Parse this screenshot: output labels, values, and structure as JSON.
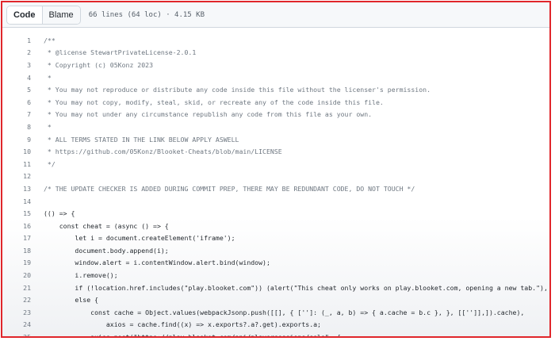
{
  "toolbar": {
    "code_label": "Code",
    "blame_label": "Blame",
    "file_meta": "66 lines (64 loc) · 4.15 KB"
  },
  "code_lines": [
    {
      "n": "1",
      "text": "/**",
      "kind": "comment"
    },
    {
      "n": "2",
      "text": " * @license StewartPrivateLicense-2.0.1",
      "kind": "comment"
    },
    {
      "n": "3",
      "text": " * Copyright (c) 05Konz 2023",
      "kind": "comment"
    },
    {
      "n": "4",
      "text": " *",
      "kind": "comment"
    },
    {
      "n": "5",
      "text": " * You may not reproduce or distribute any code inside this file without the licenser's permission.",
      "kind": "comment"
    },
    {
      "n": "6",
      "text": " * You may not copy, modify, steal, skid, or recreate any of the code inside this file.",
      "kind": "comment"
    },
    {
      "n": "7",
      "text": " * You may not under any circumstance republish any code from this file as your own.",
      "kind": "comment"
    },
    {
      "n": "8",
      "text": " *",
      "kind": "comment"
    },
    {
      "n": "9",
      "text": " * ALL TERMS STATED IN THE LINK BELOW APPLY ASWELL",
      "kind": "comment"
    },
    {
      "n": "10",
      "text": " * https://github.com/05Konz/Blooket-Cheats/blob/main/LICENSE",
      "kind": "comment"
    },
    {
      "n": "11",
      "text": " */",
      "kind": "comment"
    },
    {
      "n": "12",
      "text": "",
      "kind": "code"
    },
    {
      "n": "13",
      "text": "/* THE UPDATE CHECKER IS ADDED DURING COMMIT PREP, THERE MAY BE REDUNDANT CODE, DO NOT TOUCH */",
      "kind": "comment"
    },
    {
      "n": "14",
      "text": "",
      "kind": "code"
    },
    {
      "n": "15",
      "text": "(() => {",
      "kind": "code"
    },
    {
      "n": "16",
      "text": "    const cheat = (async () => {",
      "kind": "code"
    },
    {
      "n": "17",
      "text": "        let i = document.createElement('iframe');",
      "kind": "code"
    },
    {
      "n": "18",
      "text": "        document.body.append(i);",
      "kind": "code"
    },
    {
      "n": "19",
      "text": "        window.alert = i.contentWindow.alert.bind(window);",
      "kind": "code"
    },
    {
      "n": "20",
      "text": "        i.remove();",
      "kind": "code"
    },
    {
      "n": "21",
      "text": "        if (!location.href.includes(\"play.blooket.com\")) (alert(\"This cheat only works on play.blooket.com, opening a new tab.\"), window.open(\"https://play.blooket.com/\"));",
      "kind": "code"
    },
    {
      "n": "22",
      "text": "        else {",
      "kind": "code"
    },
    {
      "n": "23",
      "text": "            const cache = Object.values(webpackJsonp.push([[], { ['']: (_, a, b) => { a.cache = b.c }, }, [['']],]).cache),",
      "kind": "code"
    },
    {
      "n": "24",
      "text": "                axios = cache.find((x) => x.exports?.a?.get).exports.a;",
      "kind": "code"
    },
    {
      "n": "25",
      "text": "            axios.post(\"https://play.blooket.com/api/playersessions/solo\", {",
      "kind": "code"
    }
  ]
}
